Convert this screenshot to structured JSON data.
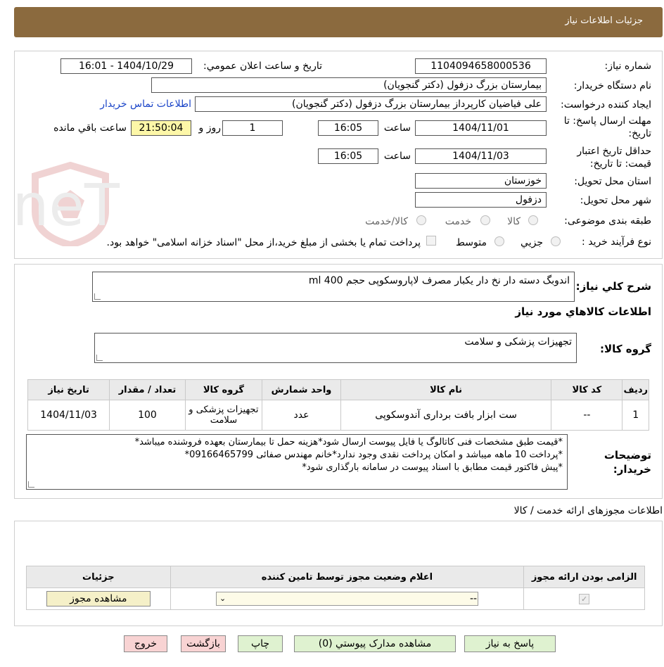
{
  "header": {
    "title": "جزئیات اطلاعات نیاز"
  },
  "watermark_text": "AriaTender.neT",
  "form": {
    "need_no_label": "شماره نیاز:",
    "need_no": "1104094658000536",
    "announce_label": "تاریخ و ساعت اعلان عمومي:",
    "announce_value": "1404/10/29 - 16:01",
    "buyer_label": "نام دستگاه خريدار:",
    "buyer_value": "بیمارستان بزرگ دزفول (دکتر گنجویان)",
    "creator_label": "ایجاد کننده درخواست:",
    "creator_value": "علی فیاضیان کارپرداز بیمارستان بزرگ دزفول (دکتر گنجویان)",
    "contact_link": "اطلاعات تماس خريدار",
    "deadline_label_1": "مهلت ارسال پاسخ: تا",
    "deadline_label_2": "تاريخ:",
    "deadline_date": "1404/11/01",
    "time_label": "ساعت",
    "deadline_time": "16:05",
    "days_value": "1",
    "days_label": "روز و",
    "remaining_value": "21:50:04",
    "remaining_label": "ساعت باقي مانده",
    "validity_label_1": "حداقل تاريخ اعتبار",
    "validity_label_2": "قيمت: تا تاريخ:",
    "validity_date": "1404/11/03",
    "validity_time": "16:05",
    "province_label": "استان محل تحويل:",
    "province_value": "خوزستان",
    "city_label": "شهر محل تحويل:",
    "city_value": "دزفول",
    "category_label": "طبقه بندی موضوعی:",
    "category_options": [
      "کالا",
      "خدمت",
      "کالا/خدمت"
    ],
    "process_label": "نوع فرآيند خريد :",
    "process_options": [
      "جزيي",
      "متوسط"
    ],
    "process_note": "پرداخت تمام يا بخشی از مبلغ خريد،از محل \"اسناد خزانه اسلامی\" خواهد بود."
  },
  "summary": {
    "desc_label": "شرح کلي نياز:",
    "desc_value": "اندوبگ دسته دار نخ دار یکبار مصرف لاپاروسکوپی حجم 400 ml",
    "goods_info_title": "اطلاعات کالاهاي مورد نياز",
    "group_label": "گروه کالا:",
    "group_value": "تجهیزات پزشکی و سلامت"
  },
  "goods_table": {
    "headers": [
      "رديف",
      "کد کالا",
      "نام کالا",
      "واحد شمارش",
      "گروه کالا",
      "تعداد / مقدار",
      "تاريخ نياز"
    ],
    "rows": [
      [
        "1",
        "--",
        "ست ابزار بافت برداری آندوسکوپی",
        "عدد",
        "تجهیزات پزشکی و سلامت",
        "100",
        "1404/11/03"
      ]
    ]
  },
  "buyer_notes": {
    "label_1": "توضيحات",
    "label_2": "خريدار:",
    "lines": [
      "*قیمت طبق مشخصات فنی کاتالوگ یا فایل پیوست ارسال شود*هزینه حمل تا بیمارستان بعهده فروشنده میباشد*",
      "*پرداخت 10 ماهه میباشد و امکان پرداخت نقدی وجود ندارد*خانم مهندس صفائی 09166465799*",
      "*پیش فاکتور قیمت مطابق با اسناد پیوست در سامانه بارگذاری شود*"
    ]
  },
  "license": {
    "title": "اطلاعات مجوزهای ارائه خدمت / کالا",
    "headers": [
      "الزامی بودن ارائه مجوز",
      "اعلام وضعیت مجوز توسط تامین کننده",
      "جزئیات"
    ],
    "select_value": "--",
    "view_button": "مشاهده مجوز"
  },
  "buttons": {
    "reply": "پاسخ به نياز",
    "attachments": "مشاهده مدارک پيوستي (0)",
    "print": "چاپ",
    "back": "بازگشت",
    "exit": "خروج"
  }
}
